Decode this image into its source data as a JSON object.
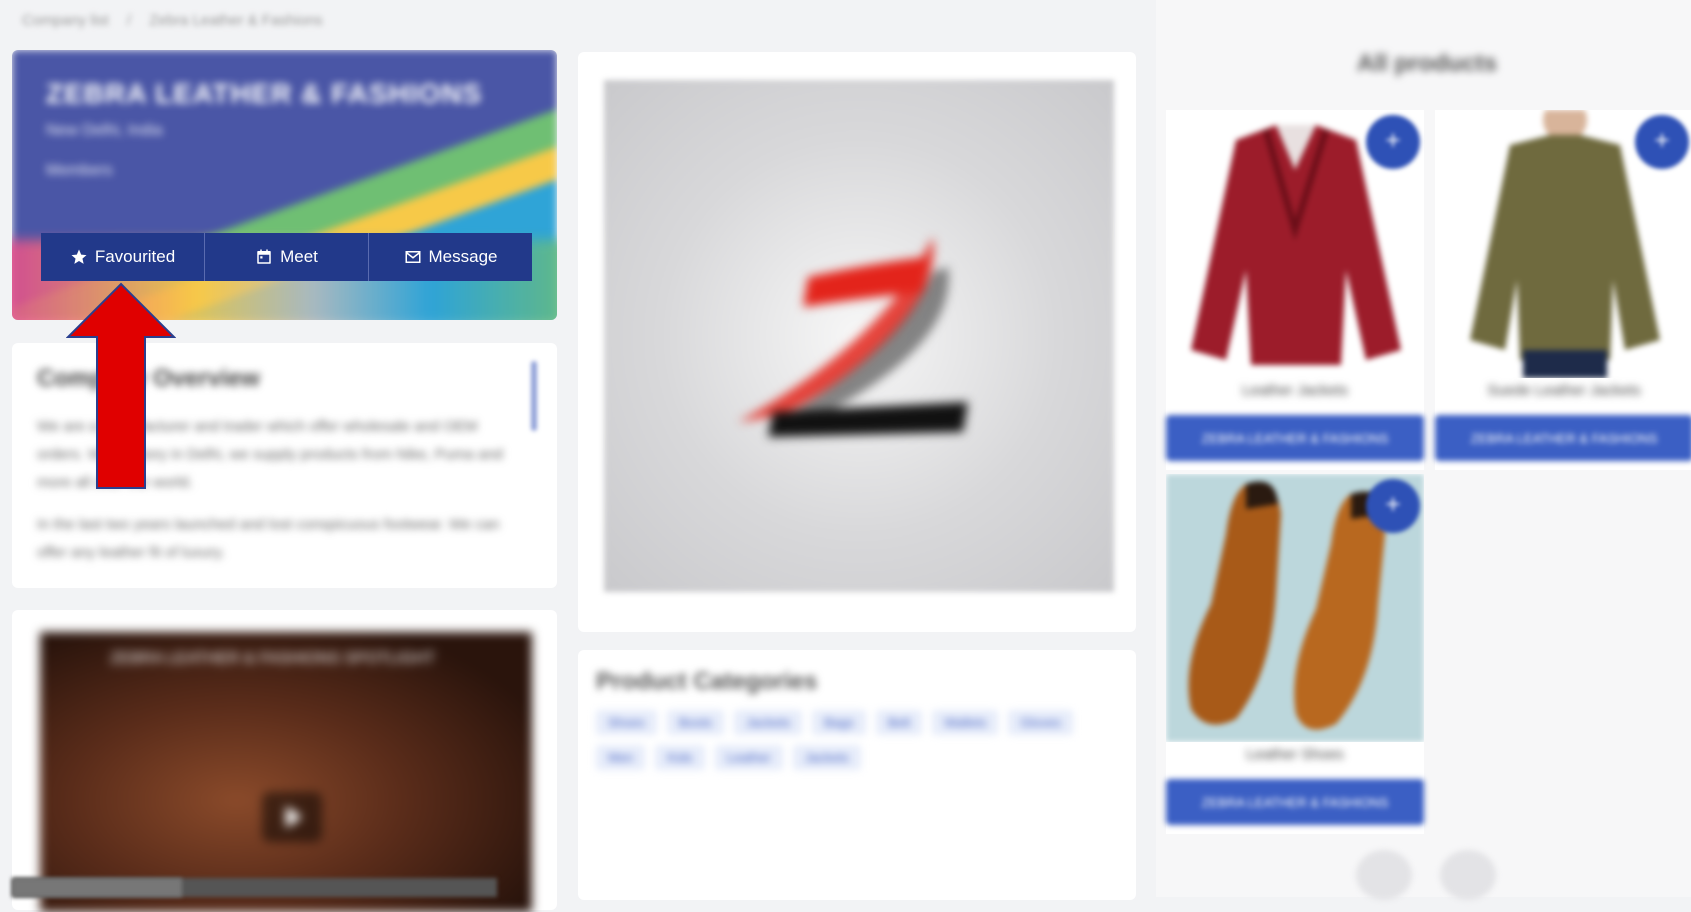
{
  "breadcrumb": {
    "items": [
      "Company list",
      "Zebra Leather & Fashions"
    ]
  },
  "profile": {
    "name": "ZEBRA LEATHER & FASHIONS",
    "location": "New Delhi, India",
    "category": "Members",
    "actions": {
      "favourite_label": "Favourited",
      "meet_label": "Meet",
      "message_label": "Message"
    }
  },
  "overview": {
    "title": "Company Overview",
    "paragraph1": "We are a manufacturer and trader which offer wholesale and OEM orders. With factory in Delhi, we supply products from Nike, Puma and more all over the world.",
    "paragraph2": "In the last two years launched and lost conspicuous footwear. We can offer any leather fit of luxury."
  },
  "video": {
    "title": "ZEBRA LEATHER & FASHIONS SPOTLIGHT"
  },
  "categories": {
    "title": "Product Categories",
    "tags": [
      "Shoes",
      "Boots",
      "Jackets",
      "Bags",
      "Belt",
      "Wallets",
      "Gloves",
      "Men",
      "Kids",
      "Leather",
      "Jackets"
    ]
  },
  "products": {
    "title": "All products",
    "items": [
      {
        "name": "Leather Jackets",
        "button_label": "ZEBRA LEATHER & FASHIONS"
      },
      {
        "name": "Suede Leather Jackets",
        "button_label": "ZEBRA LEATHER & FASHIONS"
      },
      {
        "name": "Leather Shoes",
        "button_label": "ZEBRA LEATHER & FASHIONS"
      }
    ]
  },
  "colors": {
    "brand": "#22398a",
    "accent": "#3b5fc4",
    "arrow": "#e00000"
  },
  "icons": {
    "favourite": "star-icon",
    "meet": "calendar-icon",
    "message": "mail-icon"
  }
}
